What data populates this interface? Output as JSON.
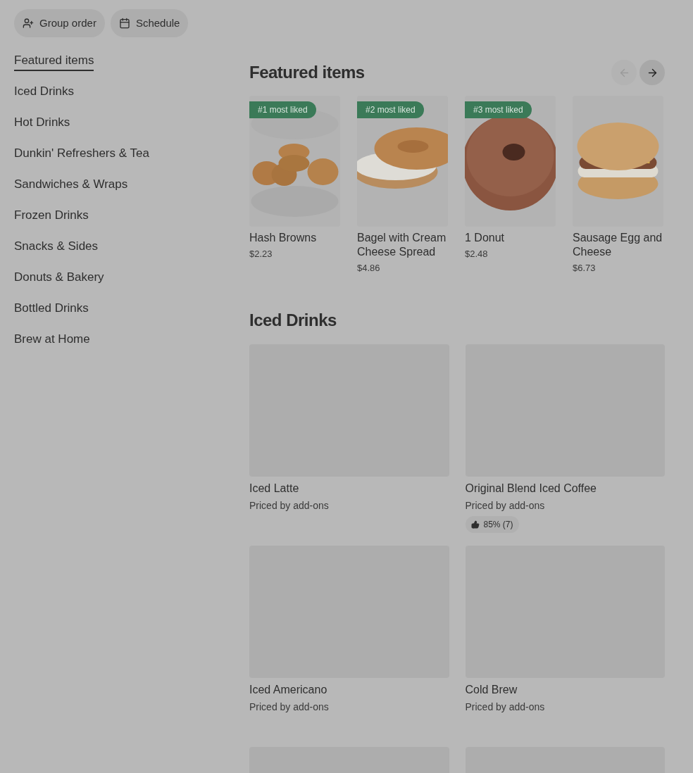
{
  "header_buttons": [
    {
      "kind": "group",
      "label": "Group order"
    },
    {
      "kind": "schedule",
      "label": "Schedule"
    }
  ],
  "sidebar": {
    "items": [
      {
        "label": "Featured items",
        "selected": true
      },
      {
        "label": "Iced Drinks",
        "selected": false
      },
      {
        "label": "Hot Drinks",
        "selected": false
      },
      {
        "label": "Dunkin' Refreshers & Tea",
        "selected": false
      },
      {
        "label": "Sandwiches & Wraps",
        "selected": false
      },
      {
        "label": "Frozen Drinks",
        "selected": false
      },
      {
        "label": "Snacks & Sides",
        "selected": false
      },
      {
        "label": "Donuts & Bakery",
        "selected": false
      },
      {
        "label": "Bottled Drinks",
        "selected": false
      },
      {
        "label": "Brew at Home",
        "selected": false
      }
    ]
  },
  "featured": {
    "title": "Featured items",
    "prev_disabled": true,
    "next_disabled": false,
    "items": [
      {
        "badge": "#1 most liked",
        "name": "Hash Browns",
        "price": "$2.23"
      },
      {
        "badge": "#2 most liked",
        "name": "Bagel with Cream Cheese Spread",
        "price": "$4.86"
      },
      {
        "badge": "#3 most liked",
        "name": "1 Donut",
        "price": "$2.48"
      },
      {
        "name": "Sausage Egg and Cheese",
        "price": "$6.73"
      }
    ]
  },
  "iced_drinks": {
    "title": "Iced Drinks",
    "items": [
      {
        "kind": "item",
        "name": "Iced Latte",
        "price": "Priced by add-ons"
      },
      {
        "kind": "item",
        "name": "Original Blend Iced Coffee",
        "price": "Priced by add-ons",
        "rating": "85% (7)"
      },
      {
        "kind": "item",
        "name": "Iced Americano",
        "price": "Priced by add-ons"
      },
      {
        "kind": "item",
        "name": "Cold Brew",
        "price": "Priced by add-ons"
      },
      {
        "kind": "image_only"
      },
      {
        "kind": "image_only"
      }
    ]
  }
}
